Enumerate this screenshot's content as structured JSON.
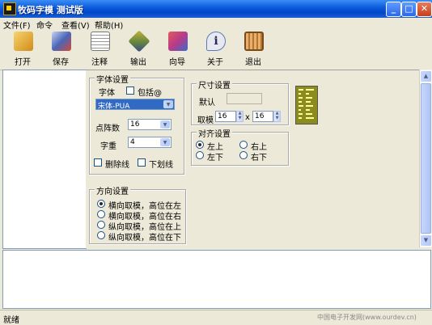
{
  "window": {
    "title": "牧码字模 测试版",
    "controls": {
      "minimize": "_",
      "maximize": "□",
      "close": "✕"
    }
  },
  "menu": [
    {
      "label": "文件(F)"
    },
    {
      "label": "命令"
    },
    {
      "label": "查看(V)"
    },
    {
      "label": "帮助(H)"
    }
  ],
  "toolbar": [
    {
      "label": "打开",
      "icon": "open-folder-icon",
      "color": "#d08c1c"
    },
    {
      "label": "保存",
      "icon": "save-books-icon",
      "color": "#4a66b8"
    },
    {
      "label": "注释",
      "icon": "notepad-pen-icon",
      "color": "#c8c8c8"
    },
    {
      "label": "输出",
      "icon": "export-book-icon",
      "color": "#6a8a3a"
    },
    {
      "label": "向导",
      "icon": "wizard-icon",
      "color": "#b83a8a"
    },
    {
      "label": "关于",
      "icon": "info-icon",
      "color": "#5a7ab8"
    },
    {
      "label": "退出",
      "icon": "exit-door-icon",
      "color": "#b8742a"
    }
  ],
  "font_settings": {
    "title": "字体设置",
    "font_label": "字体",
    "include_at_label": "包括@",
    "include_at_checked": false,
    "font_value": "宋体-PUA",
    "matrix_label": "点阵数",
    "matrix_value": "16",
    "weight_label": "字重",
    "weight_value": "4",
    "strikethrough_label": "删除线",
    "strikethrough_checked": false,
    "underline_label": "下划线",
    "underline_checked": false
  },
  "size_settings": {
    "title": "尺寸设置",
    "default_label": "默认",
    "default_value": "",
    "sample_label": "取模",
    "width_value": "16",
    "times": "x",
    "height_value": "16"
  },
  "align_settings": {
    "title": "对齐设置",
    "options": [
      {
        "label": "左上",
        "checked": true
      },
      {
        "label": "右上",
        "checked": false
      },
      {
        "label": "左下",
        "checked": false
      },
      {
        "label": "右下",
        "checked": false
      }
    ]
  },
  "direction_settings": {
    "title": "方向设置",
    "options": [
      {
        "label": "横向取模，高位在左",
        "checked": true
      },
      {
        "label": "横向取模，高位在右",
        "checked": false
      },
      {
        "label": "纵向取模，高位在上",
        "checked": false
      },
      {
        "label": "纵向取模，高位在下",
        "checked": false
      }
    ]
  },
  "status": {
    "text": "就绪",
    "watermark": "中国电子开发网(www.ourdev.cn)"
  },
  "colors": {
    "titlebar": "#0A58DC",
    "window_bg": "#ECE9D8",
    "selection": "#316AC5",
    "preview_bg": "#8B8B1E",
    "preview_fg": "#FFFF9C"
  }
}
